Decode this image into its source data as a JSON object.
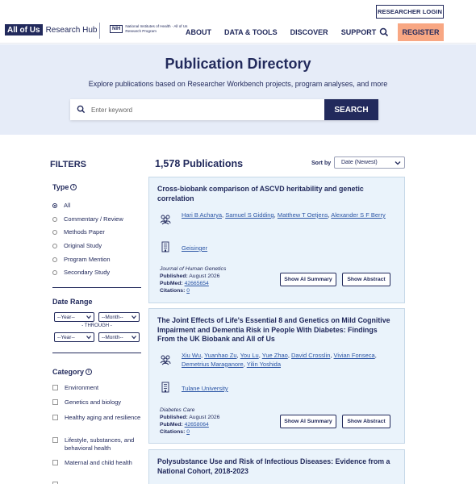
{
  "header": {
    "researcher_login": "RESEARCHER LOGIN",
    "logo_mark": "All of Us",
    "logo_text": "Research Hub",
    "nih_badge": "NIH",
    "nih_text": "National Institutes of Health · All of Us Research Program",
    "nav": [
      "ABOUT",
      "DATA & TOOLS",
      "DISCOVER",
      "SUPPORT"
    ],
    "register": "REGISTER"
  },
  "hero": {
    "title": "Publication Directory",
    "subtitle": "Explore publications based on Researcher Workbench projects, program analyses, and more",
    "search_placeholder": "Enter keyword",
    "search_button": "SEARCH"
  },
  "filters": {
    "title": "FILTERS",
    "type": {
      "label": "Type",
      "options": [
        "All",
        "Commentary / Review",
        "Methods Paper",
        "Original Study",
        "Program Mention",
        "Secondary Study"
      ],
      "selected": "All"
    },
    "date_range": {
      "label": "Date Range",
      "year_placeholder": "--Year--",
      "month_placeholder": "--Month--",
      "through": "- THROUGH -"
    },
    "category": {
      "label": "Category",
      "options": [
        "Environment",
        "Genetics and biology",
        "Healthy aging and resilience",
        "Lifestyle, substances, and behavioral health",
        "Maternal and child health"
      ]
    }
  },
  "results": {
    "count_label": "1,578 Publications",
    "sort_label": "Sort by",
    "sort_value": "Date (Newest)",
    "show_ai_summary": "Show AI Summary",
    "show_abstract": "Show Abstract",
    "published_label": "Published:",
    "pubmed_label": "PubMed:",
    "citations_label": "Citations:",
    "cards": [
      {
        "title": "Cross-biobank comparison of ASCVD heritability and genetic correlation",
        "authors": [
          "Hari B Acharya",
          "Samuel S Gidding",
          "Matthew T Oetjens",
          "Alexander S F Berry"
        ],
        "institution": "Geisinger",
        "journal": "Journal of Human Genetics",
        "published": "August 2026",
        "pubmed": "42665654",
        "citations": "0"
      },
      {
        "title": "The Joint Effects of Life's Essential 8 and Genetics on Mild Cognitive Impairment and Dementia Risk in People With Diabetes: Findings From the UK Biobank and All of Us",
        "authors": [
          "Xiu Wu",
          "Yuanhao Zu",
          "You Lu",
          "Yue Zhao",
          "David Crosslin",
          "Vivian Fonseca",
          "Demetrius Maraganore",
          "Yilin Yoshida"
        ],
        "institution": "Tulane University",
        "journal": "Diabetes Care",
        "published": "August 2026",
        "pubmed": "42658064",
        "citations": "0"
      },
      {
        "title": "Polysubstance Use and Risk of Infectious Diseases: Evidence from a National Cohort, 2018-2023"
      }
    ]
  }
}
